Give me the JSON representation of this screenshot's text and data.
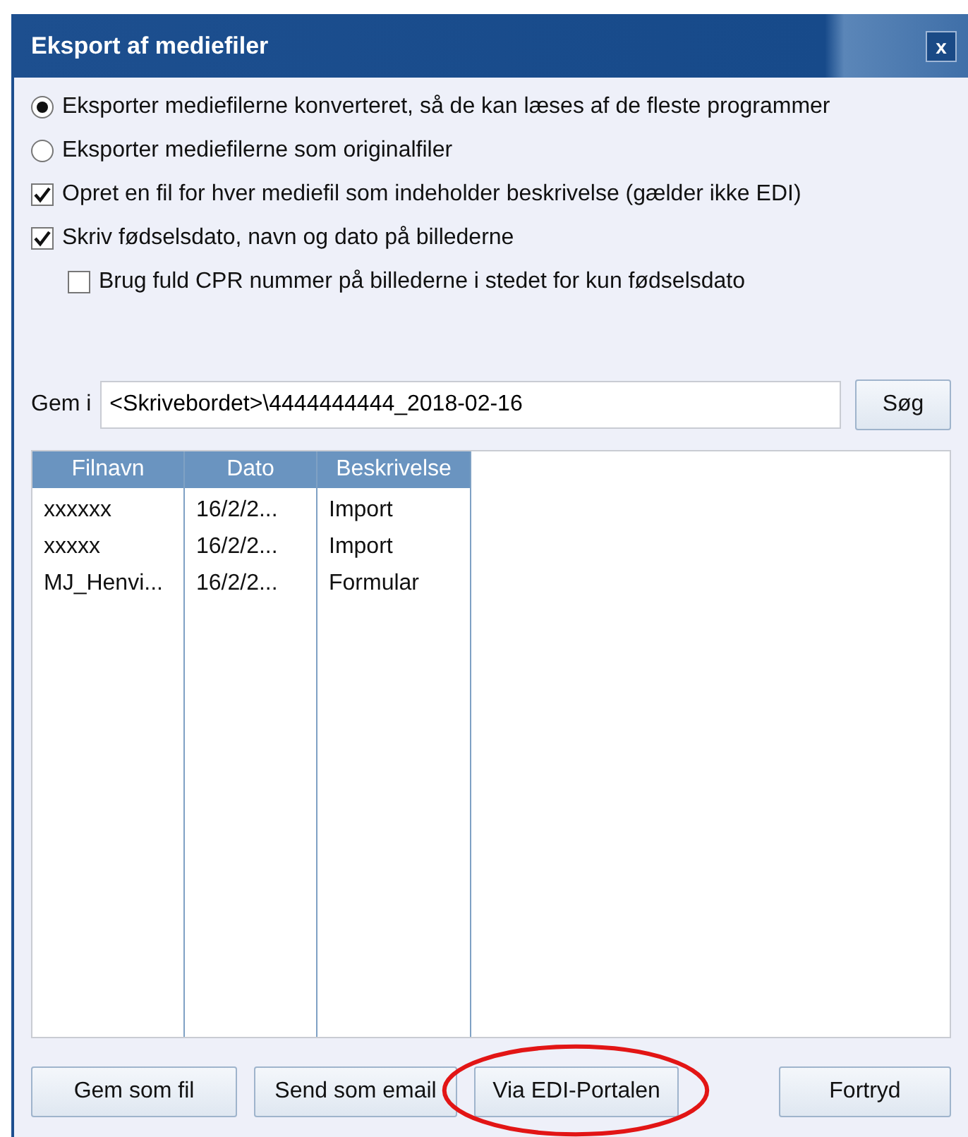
{
  "window": {
    "title": "Eksport af mediefiler",
    "close": "x"
  },
  "options": [
    {
      "kind": "radio",
      "label": "Eksporter mediefilerne konverteret, så de kan læses af de fleste programmer",
      "selected": true
    },
    {
      "kind": "radio",
      "label": "Eksporter mediefilerne som originalfiler",
      "selected": false
    },
    {
      "kind": "checkbox",
      "label": "Opret en fil for hver mediefil som indeholder beskrivelse (gælder ikke EDI)",
      "checked": true
    },
    {
      "kind": "checkbox",
      "label": "Skriv fødselsdato, navn og dato på billederne",
      "checked": true,
      "children": [
        {
          "kind": "checkbox",
          "label": "Brug fuld CPR nummer på billederne i stedet for kun fødselsdato",
          "checked": false
        }
      ]
    }
  ],
  "save_in": {
    "label": "Gem i",
    "value": "<Skrivebordet>\\4444444444_2018-02-16",
    "button": "Søg"
  },
  "table": {
    "columns": [
      "Filnavn",
      "Dato",
      "Beskrivelse"
    ],
    "rows": [
      [
        "xxxxxx",
        "16/2/2...",
        "Import"
      ],
      [
        "xxxxx",
        "16/2/2...",
        "Import"
      ],
      [
        "MJ_Henvi...",
        "16/2/2...",
        "Formular"
      ]
    ]
  },
  "buttons": [
    {
      "label": "Gem som fil",
      "circled": false
    },
    {
      "label": "Send som email",
      "circled": false
    },
    {
      "label": "Via EDI-Portalen",
      "circled": true
    },
    {
      "label": "Fortryd",
      "circled": false
    }
  ]
}
